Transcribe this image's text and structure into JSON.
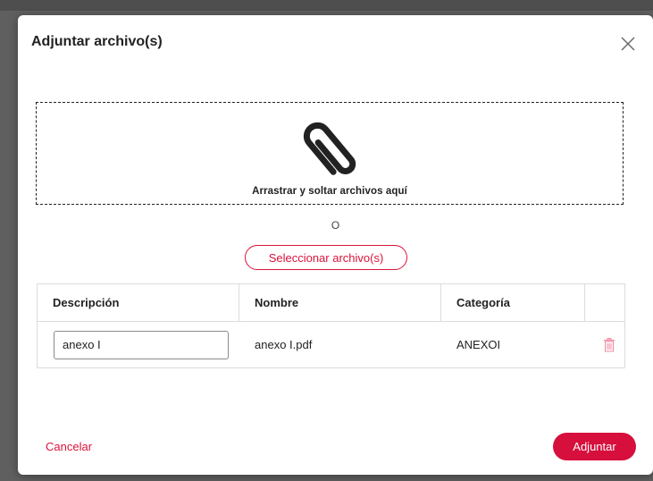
{
  "dialog": {
    "title": "Adjuntar archivo(s)",
    "close_icon": "close-icon"
  },
  "dropzone": {
    "icon": "paperclip-icon",
    "text": "Arrastrar y soltar archivos aquí"
  },
  "or_text": "O",
  "select_button": "Seleccionar archivo(s)",
  "table": {
    "headers": [
      "Descripción",
      "Nombre",
      "Categoría",
      ""
    ],
    "rows": [
      {
        "description": "anexo I",
        "name": "anexo I.pdf",
        "category": "ANEXOI",
        "delete_icon": "trash-icon"
      }
    ]
  },
  "footer": {
    "cancel_label": "Cancelar",
    "attach_label": "Adjuntar"
  },
  "colors": {
    "accent": "#d9133c",
    "backdrop": "#5f5f5f"
  }
}
